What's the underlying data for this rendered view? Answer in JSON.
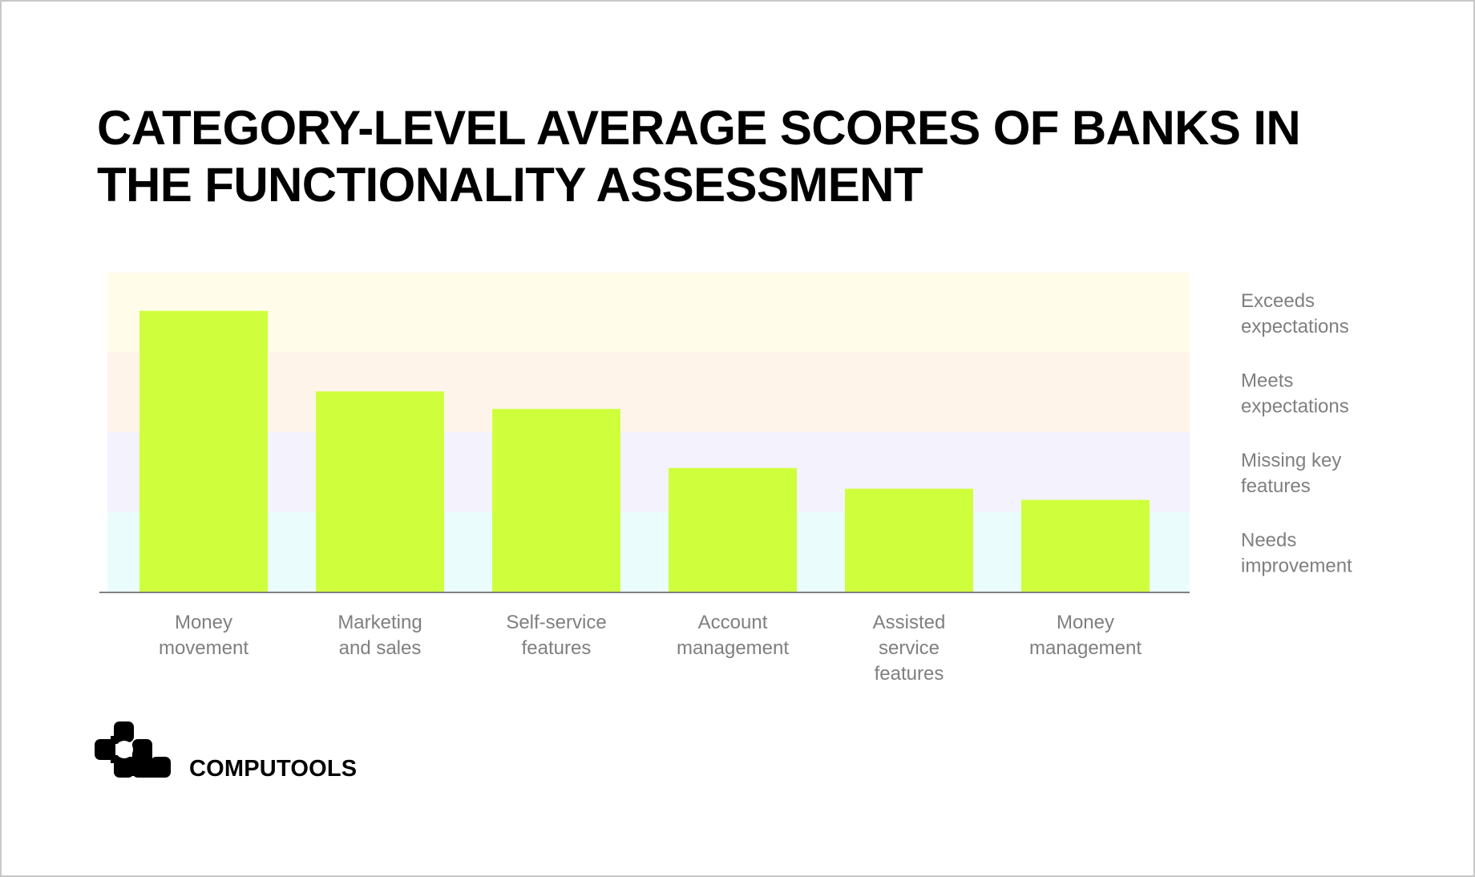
{
  "title": {
    "lines": [
      "CATEGORY-LEVEL AVERAGE SCORES OF BANKS IN",
      "THE FUNCTIONALITY ASSESSMENT"
    ]
  },
  "brand": {
    "name": "COMPUTOOLS",
    "logo_icon": "computools-logo-icon"
  },
  "colors": {
    "bar": "#CFFF3C",
    "axis": "#808080",
    "label_text": "#7F7F7F",
    "title_text": "#000000"
  },
  "chart_data": {
    "type": "bar",
    "title": "CATEGORY-LEVEL AVERAGE SCORES OF BANKS IN THE FUNCTIONALITY ASSESSMENT",
    "xlabel": "",
    "ylabel": "",
    "ylim": [
      0,
      4
    ],
    "grid": false,
    "categories": [
      [
        "Money",
        "movement"
      ],
      [
        "Marketing",
        "and sales"
      ],
      [
        "Self-service",
        "features"
      ],
      [
        "Account",
        "management"
      ],
      [
        "Assisted",
        "service",
        "features"
      ],
      [
        "Money",
        "management"
      ]
    ],
    "category_names": [
      "Money movement",
      "Marketing and sales",
      "Self-service features",
      "Account management",
      "Assisted service features",
      "Money management"
    ],
    "values": [
      3.52,
      2.51,
      2.29,
      1.55,
      1.29,
      1.15
    ],
    "bands": [
      {
        "from": 3,
        "to": 4,
        "label": [
          "Exceeds",
          "expectations"
        ],
        "color": "#FFFDE9"
      },
      {
        "from": 2,
        "to": 3,
        "label": [
          "Meets",
          "expectations"
        ],
        "color": "#FEF4EA"
      },
      {
        "from": 1,
        "to": 2,
        "label": [
          "Missing key",
          "features"
        ],
        "color": "#F3F2FD"
      },
      {
        "from": 0,
        "to": 1,
        "label": [
          "Needs",
          "improvement"
        ],
        "color": "#EBFCFC"
      }
    ],
    "legend_placement": "right"
  }
}
